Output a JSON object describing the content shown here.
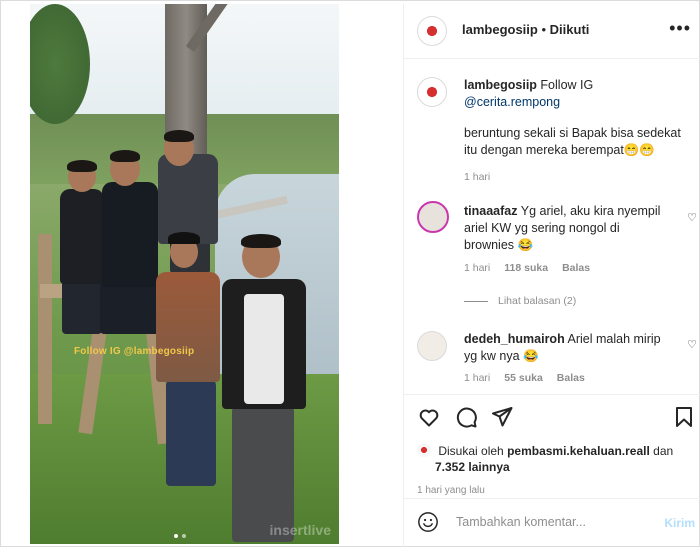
{
  "post": {
    "username": "lambegosiip",
    "separator": "•",
    "follow_status": "Diikuti",
    "more_label": "•••"
  },
  "photo": {
    "watermark_text": "Follow IG @lambegosiip",
    "brand_watermark": "insertlive"
  },
  "caption": {
    "username": "lambegosiip",
    "text_before_link": "Follow IG",
    "link": "@cerita.rempong",
    "body": "beruntung sekali si Bapak bisa sedekat itu dengan mereka berempat😁😁",
    "time": "1 hari"
  },
  "comments": [
    {
      "username": "tinaaafaz",
      "text": "Yg ariel, aku kira nyempil ariel KW yg sering nongol di brownies 😂",
      "time": "1 hari",
      "likes": "118 suka",
      "reply": "Balas"
    },
    {
      "username": "dedeh_humairoh",
      "text": "Ariel malah mirip yg kw nya 😂",
      "time": "1 hari",
      "likes": "55 suka",
      "reply": "Balas"
    }
  ],
  "view_replies": "Lihat balasan (2)",
  "likes_line": {
    "prefix": "Disukai oleh",
    "user": "pembasmi.kehaluan.reall",
    "middle": "dan",
    "count": "7.352 lainnya"
  },
  "post_time": "1 hari yang lalu",
  "add_comment": {
    "placeholder": "Tambahkan komentar...",
    "post_label": "Kirim"
  },
  "colors": {
    "link": "#00376b",
    "muted": "#8e8e8e",
    "post_disabled": "#b2dffc"
  }
}
